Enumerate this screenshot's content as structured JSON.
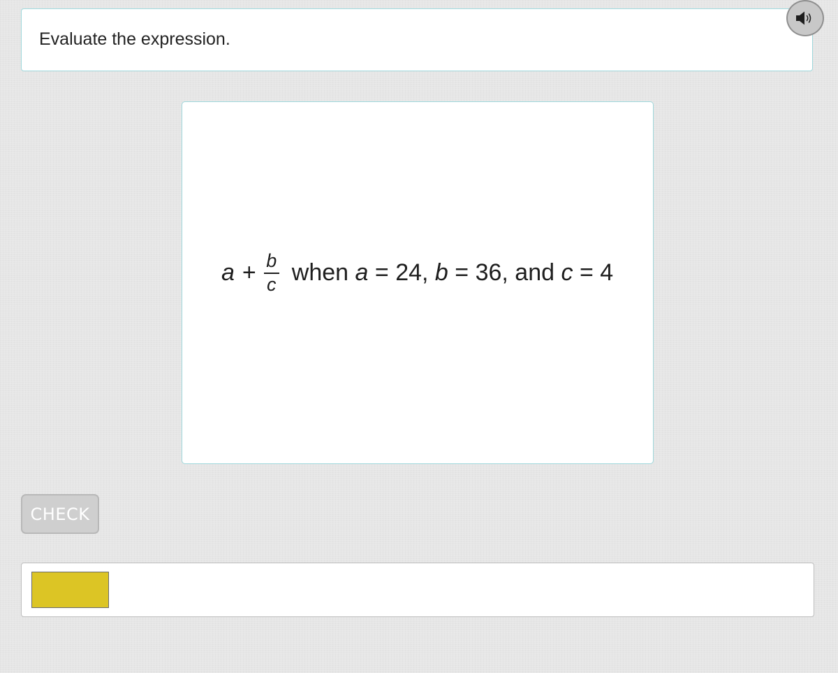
{
  "prompt": {
    "text": "Evaluate the expression."
  },
  "audio_button": {
    "icon": "speaker-icon"
  },
  "problem": {
    "expr_var_a": "a",
    "expr_plus": "+",
    "frac_numerator": "b",
    "frac_denominator": "c",
    "word_when": "when",
    "cond_a_var": "a",
    "cond_a_val": "= 24,",
    "cond_b_var": "b",
    "cond_b_val": "= 36, and",
    "cond_c_var": "c",
    "cond_c_val": "= 4"
  },
  "check_button": {
    "label": "CHECK"
  },
  "answer_area": {
    "swatch_color": "#dcc525"
  },
  "colors": {
    "card_border": "#9fd8dc",
    "background": "#e6e6e6",
    "check_button_bg": "#cfcfcf"
  }
}
